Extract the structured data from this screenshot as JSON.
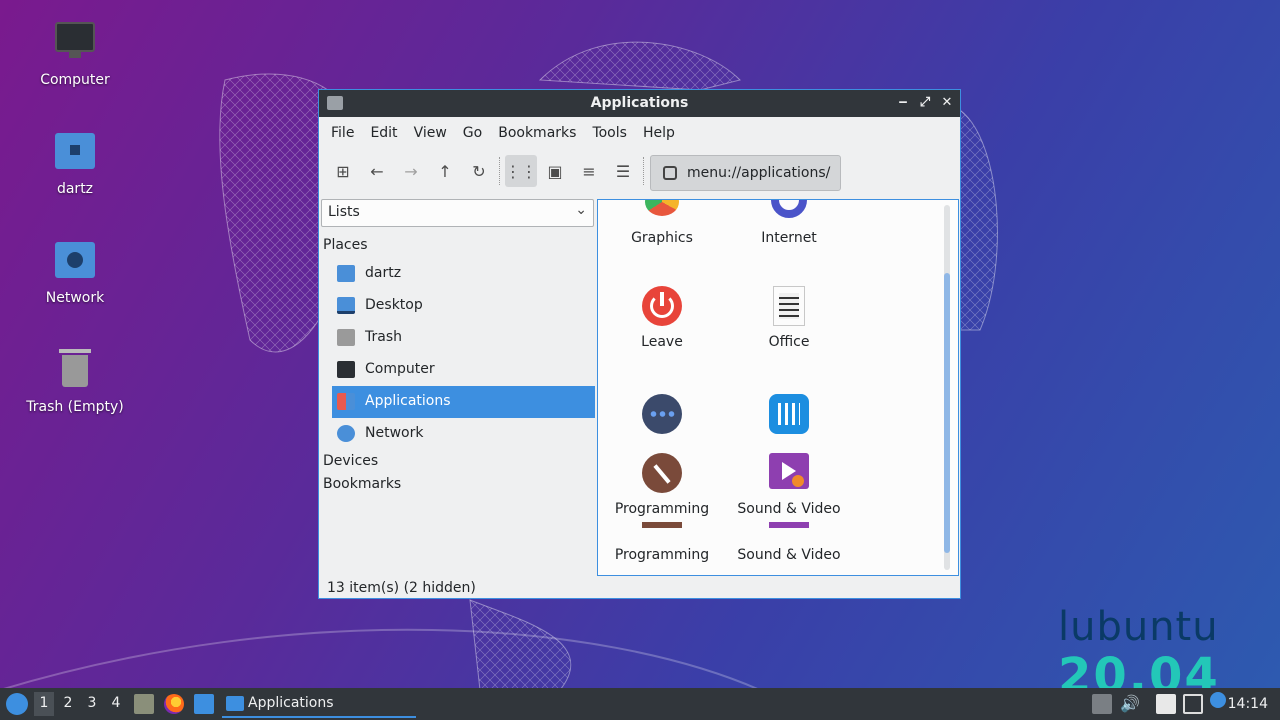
{
  "desktop": {
    "icons": [
      {
        "label": "Computer",
        "icon": "monitor-icon"
      },
      {
        "label": "dartz",
        "icon": "home-folder-icon"
      },
      {
        "label": "Network",
        "icon": "network-folder-icon"
      },
      {
        "label": "Trash (Empty)",
        "icon": "trash-icon"
      }
    ],
    "brand": "lubuntu",
    "version": "20.04"
  },
  "window": {
    "title": "Applications",
    "controls": {
      "minimize": "‒",
      "maximize": "⤢",
      "close": "✕"
    },
    "menu": [
      "File",
      "Edit",
      "View",
      "Go",
      "Bookmarks",
      "Tools",
      "Help"
    ],
    "path": "menu://applications/",
    "side_combo": "Lists",
    "sidebar": {
      "places_heading": "Places",
      "items": [
        {
          "label": "dartz",
          "icon": "home-folder-icon"
        },
        {
          "label": "Desktop",
          "icon": "desktop-icon"
        },
        {
          "label": "Trash",
          "icon": "trash-icon"
        },
        {
          "label": "Computer",
          "icon": "monitor-icon"
        },
        {
          "label": "Applications",
          "icon": "applications-icon"
        },
        {
          "label": "Network",
          "icon": "network-icon"
        }
      ],
      "devices_heading": "Devices",
      "bookmarks_heading": "Bookmarks"
    },
    "apps": [
      {
        "label": "Graphics",
        "icon": "graphics-icon"
      },
      {
        "label": "Internet",
        "icon": "internet-icon"
      },
      {
        "label": "Leave",
        "icon": "power-icon"
      },
      {
        "label": "Office",
        "icon": "office-icon"
      },
      {
        "label": "",
        "icon": "more-icon"
      },
      {
        "label": "",
        "icon": "sound-settings-icon"
      },
      {
        "label": "Programming",
        "icon": "hammer-icon"
      },
      {
        "label": "Sound & Video",
        "icon": "media-icon"
      },
      {
        "label": "Programming",
        "icon": "hammer-icon"
      },
      {
        "label": "Sound & Video",
        "icon": "media-icon"
      }
    ],
    "status": "13 item(s) (2 hidden)"
  },
  "taskbar": {
    "workspaces": [
      "1",
      "2",
      "3",
      "4"
    ],
    "task_label": "Applications",
    "clock": "14:14"
  },
  "colors": {
    "accent": "#3d8fe0",
    "titlebar": "#31363b"
  }
}
